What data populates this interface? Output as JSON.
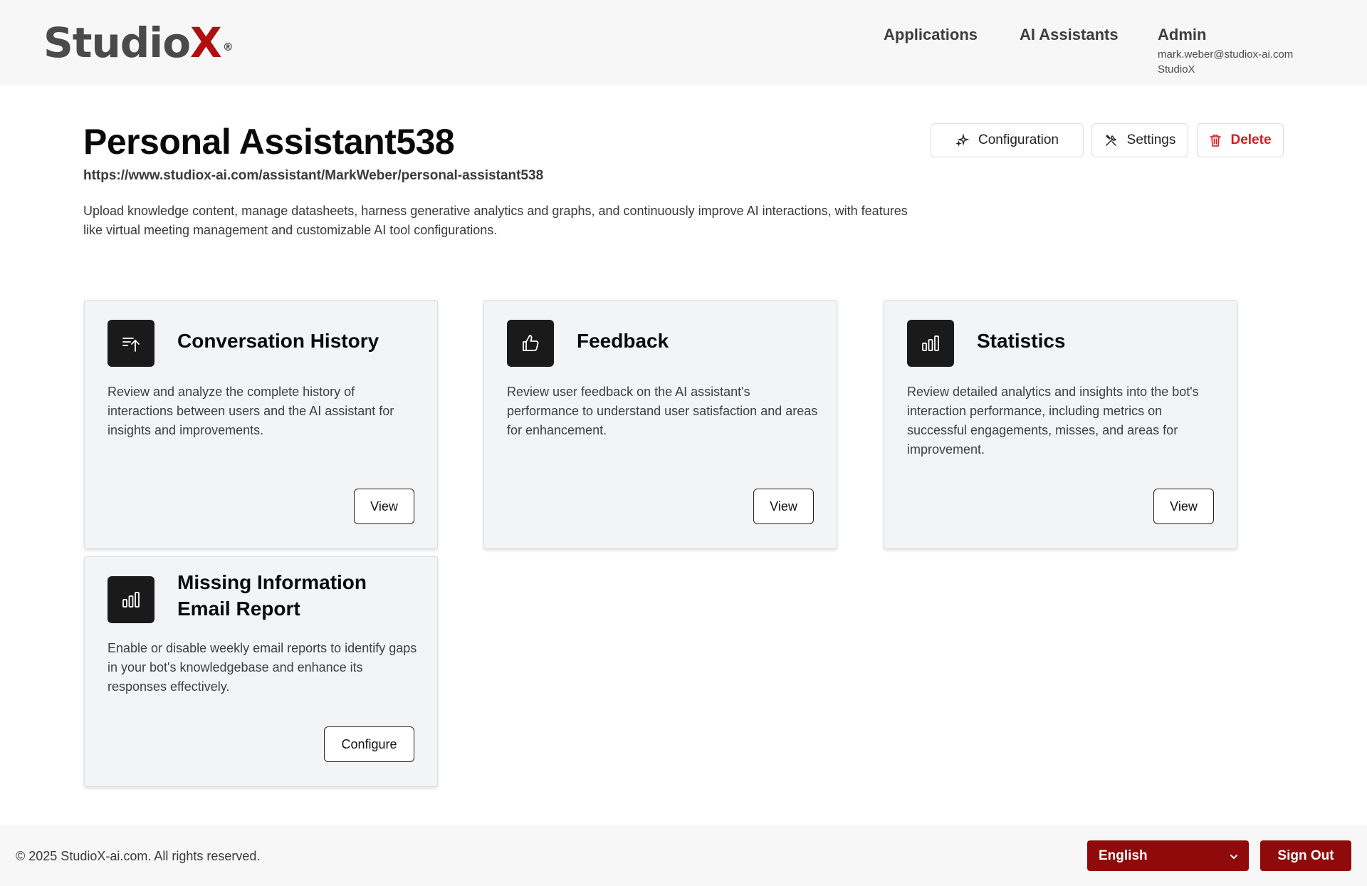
{
  "header": {
    "logo_main": "Studio",
    "logo_accent": "X",
    "logo_mark": "®",
    "nav": [
      "Applications",
      "AI Assistants"
    ],
    "admin": {
      "title": "Admin",
      "email": "mark.weber@studiox-ai.com",
      "org": "StudioX"
    }
  },
  "page": {
    "title": "Personal Assistant538",
    "url": "https://www.studiox-ai.com/assistant/MarkWeber/personal-assistant538",
    "description": "Upload knowledge content, manage datasheets, harness generative analytics and graphs, and continuously improve AI interactions, with features like virtual meeting management and customizable AI tool configurations."
  },
  "actions": {
    "configuration": "Configuration",
    "settings": "Settings",
    "delete": "Delete"
  },
  "cards": [
    {
      "title": "Conversation History",
      "text": "Review and analyze the complete history of interactions between users and the AI assistant for insights and improvements.",
      "button": "View",
      "icon": "sort-arrow-up-icon"
    },
    {
      "title": "Feedback",
      "text": "Review user feedback on the AI assistant's performance to understand user satisfaction and areas for enhancement.",
      "button": "View",
      "icon": "thumbs-up-icon"
    },
    {
      "title": "Statistics",
      "text": "Review detailed analytics and insights into the bot's interaction performance, including metrics on successful engagements, misses, and areas for improvement.",
      "button": "View",
      "icon": "bar-chart-icon"
    },
    {
      "title": "Missing Information Email Report",
      "text": "Enable or disable weekly email reports to identify gaps in your bot's knowledgebase and enhance its responses effectively.",
      "button": "Configure",
      "icon": "bar-chart-icon"
    }
  ],
  "footer": {
    "copyright": "© 2025 StudioX-ai.com.  All rights reserved.",
    "language": "English",
    "signout": "Sign Out"
  },
  "colors": {
    "brand_red": "#8f0a0a",
    "logo_red": "#b00f12",
    "delete_red": "#d31c1c"
  }
}
